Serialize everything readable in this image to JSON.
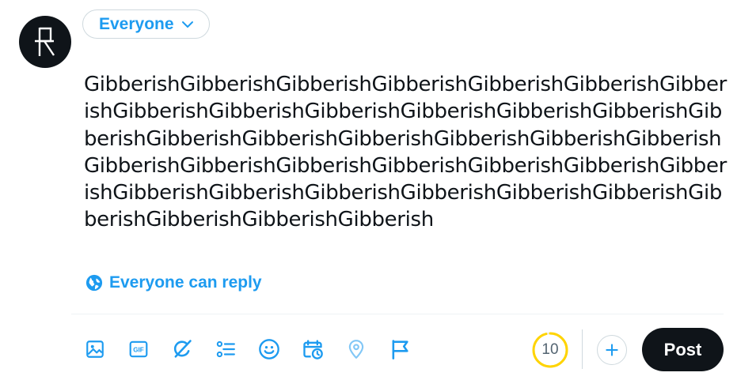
{
  "audience": {
    "label": "Everyone",
    "icon": "chevron-down-icon"
  },
  "compose": {
    "text": "GibberishGibberishGibberishGibberishGibberishGibberishGibberishGibberishGibberishGibberishGibberishGibberishGibberishGibberishGibberishGibberishGibberishGibberishGibberishGibberishGibberishGibberishGibberishGibberishGibberishGibberishGibberishGibberishGibberishGibberishGibberishGibberishGibberishGibberishGibberishGibberishGibberish"
  },
  "reply": {
    "label": "Everyone can reply",
    "icon": "globe-icon"
  },
  "toolbar": {
    "items": [
      {
        "name": "media-icon",
        "enabled": true
      },
      {
        "name": "gif-icon",
        "enabled": true
      },
      {
        "name": "grok-icon",
        "enabled": true
      },
      {
        "name": "poll-icon",
        "enabled": true
      },
      {
        "name": "emoji-icon",
        "enabled": true
      },
      {
        "name": "schedule-icon",
        "enabled": true
      },
      {
        "name": "location-icon",
        "enabled": false
      },
      {
        "name": "flag-icon",
        "enabled": true
      }
    ]
  },
  "counter": {
    "remaining": "10",
    "progress": 0.96,
    "color": "#ffd400"
  },
  "post_button": {
    "label": "Post"
  },
  "colors": {
    "accent": "#1d9bf0",
    "text": "#0f1419",
    "border": "#cfd9de"
  }
}
